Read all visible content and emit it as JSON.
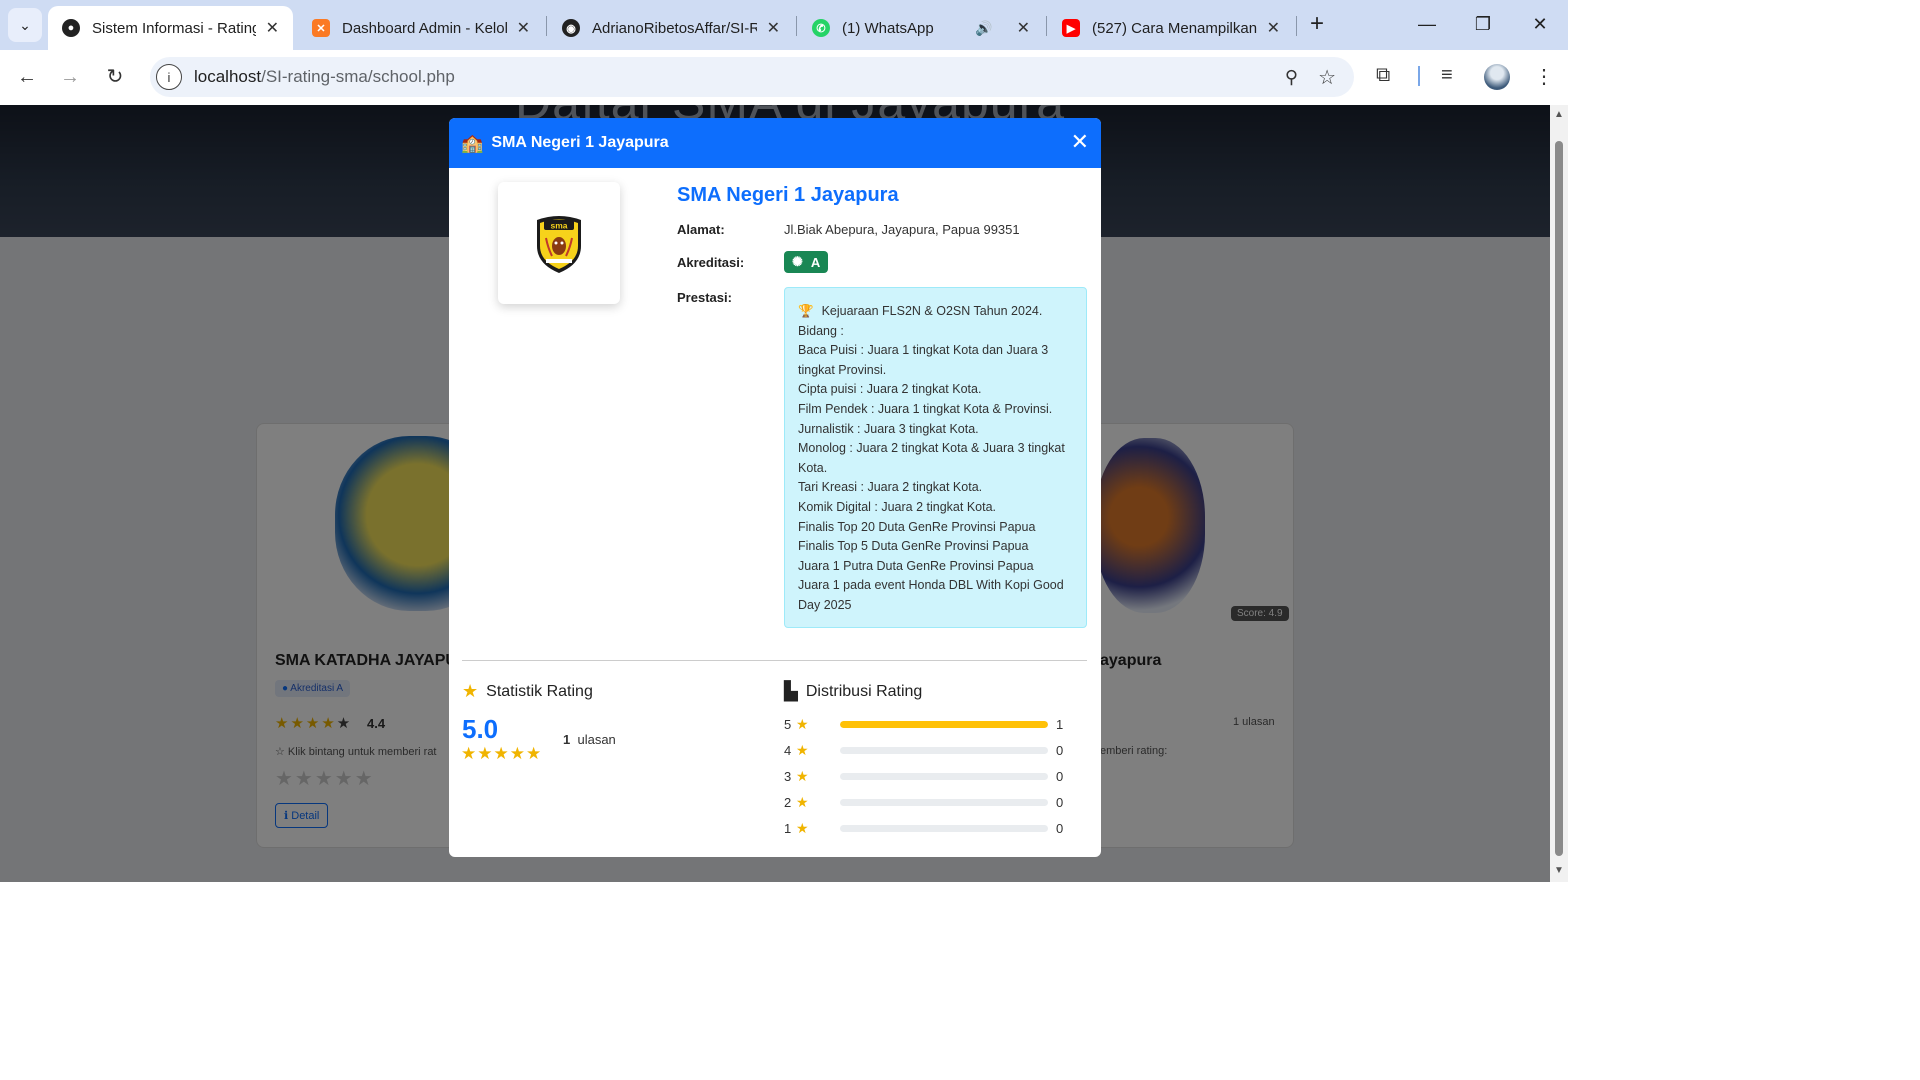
{
  "browser": {
    "tabs": [
      {
        "title": "Sistem Informasi - Rating",
        "active": true,
        "icon": "site-favicon"
      },
      {
        "title": "Dashboard Admin - Kelol",
        "active": false,
        "icon": "xampp-icon"
      },
      {
        "title": "AdrianoRibetosAffar/SI-R",
        "active": false,
        "icon": "github-icon"
      },
      {
        "title": "(1) WhatsApp",
        "active": false,
        "icon": "whatsapp-icon"
      },
      {
        "title": "(527) Cara Menampilkan",
        "active": false,
        "icon": "youtube-icon"
      }
    ],
    "url_host": "localhost",
    "url_path": "/SI-rating-sma/school.php"
  },
  "background_page": {
    "hero_title": "Daftar SMA di Jayapura",
    "left_card": {
      "name": "SMA KATADHA JAYAPU",
      "accreditation": "Akreditasi A",
      "rating": "4.4",
      "hint": "Klik bintang untuk memberi rat",
      "detail_label": "Detail"
    },
    "right_card": {
      "name": "ayapura",
      "score": "Score: 4.9",
      "reviews": "1 ulasan",
      "hint": "emberi rating:"
    }
  },
  "modal": {
    "header_title": "SMA Negeri 1 Jayapura",
    "school_name": "SMA Negeri 1 Jayapura",
    "labels": {
      "address": "Alamat:",
      "accreditation": "Akreditasi:",
      "achievements": "Prestasi:"
    },
    "address": "Jl.Biak Abepura, Jayapura, Papua 99351",
    "accreditation": "A",
    "achievements": [
      "Kejuaraan FLS2N & O2SN Tahun 2024.",
      "Bidang :",
      "Baca Puisi : Juara 1 tingkat Kota dan Juara 3 tingkat Provinsi.",
      "Cipta puisi : Juara 2 tingkat Kota.",
      "Film Pendek : Juara 1 tingkat Kota & Provinsi.",
      "Jurnalistik : Juara 3 tingkat Kota.",
      "Monolog : Juara 2 tingkat Kota & Juara 3 tingkat Kota.",
      "Tari Kreasi : Juara 2 tingkat Kota.",
      "Komik Digital : Juara 2 tingkat Kota.",
      "Finalis Top 20 Duta GenRe Provinsi Papua",
      "Finalis Top 5 Duta GenRe Provinsi Papua",
      "Juara 1 Putra Duta GenRe Provinsi Papua",
      "Juara 1 pada event Honda DBL With Kopi Good Day 2025"
    ],
    "stats": {
      "title": "Statistik Rating",
      "average": "5.0",
      "review_count": "1",
      "review_label": "ulasan"
    },
    "distribution": {
      "title": "Distribusi Rating",
      "rows": [
        {
          "star": "5",
          "count": "1",
          "fraction": 1.0
        },
        {
          "star": "4",
          "count": "0",
          "fraction": 0
        },
        {
          "star": "3",
          "count": "0",
          "fraction": 0
        },
        {
          "star": "2",
          "count": "0",
          "fraction": 0
        },
        {
          "star": "1",
          "count": "0",
          "fraction": 0
        }
      ]
    }
  },
  "colors": {
    "primary": "#0d6efd",
    "success": "#198754",
    "star": "#ffc107",
    "info_bg": "#cff4fc"
  }
}
